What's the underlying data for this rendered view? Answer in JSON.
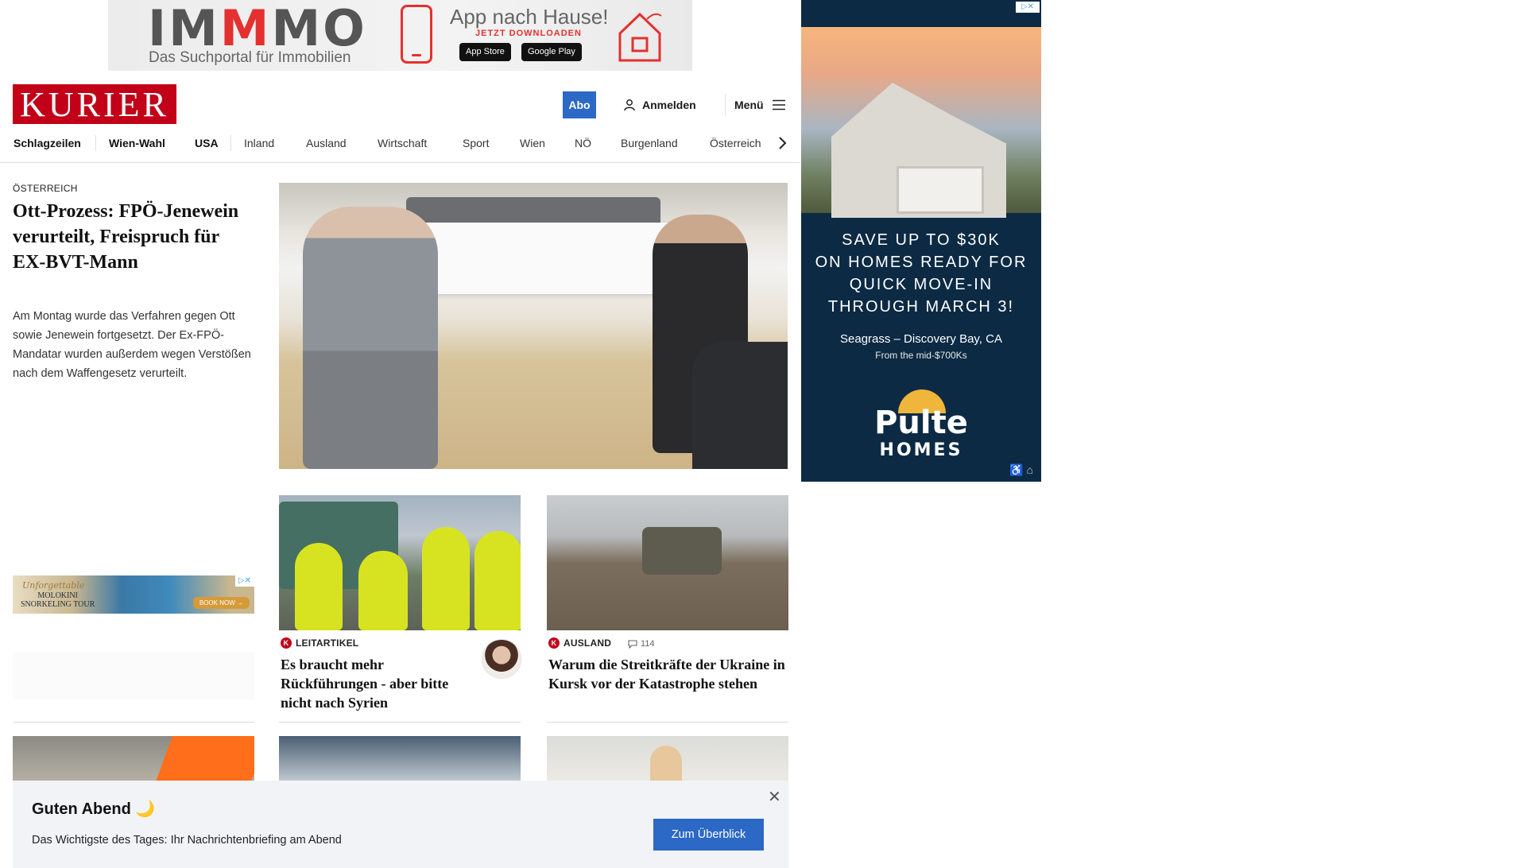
{
  "top_ad": {
    "brand_pre": "IM",
    "brand_mid": "M",
    "brand_post": "MO",
    "subline": "Das Suchportal für Immobilien",
    "headline": "App nach Hause!",
    "cta": "JETZT DOWNLOADEN",
    "appstore": "App Store",
    "googleplay": "Google Play"
  },
  "header": {
    "logo": "KURIER",
    "abo": "Abo",
    "login": "Anmelden",
    "menu": "Menü"
  },
  "nav": {
    "items": [
      "Schlagzeilen",
      "Wien-Wahl",
      "USA",
      "Inland",
      "Ausland",
      "Wirtschaft",
      "Sport",
      "Wien",
      "NÖ",
      "Burgenland",
      "Österreich"
    ]
  },
  "lead": {
    "kicker": "ÖSTERREICH",
    "title": "Ott-Prozess: FPÖ-Jenewein verurteilt, Freispruch für EX-BVT-Mann",
    "teaser": "Am Montag wurde das Verfahren gegen Ott sowie Jenewein fortgesetzt. Der Ex-FPÖ-Mandatar wurden außerdem wegen Verstößen nach dem Waffengesetz verurteilt."
  },
  "cards": [
    {
      "kicker": "LEITARTIKEL",
      "title": "Es braucht mehr Rückführungen - aber bitte nicht nach Syrien"
    },
    {
      "kicker": "AUSLAND",
      "comments": "114",
      "title": "Warum die Streitkräfte der Ukraine in Kursk vor der Katastrophe stehen"
    }
  ],
  "side_ad": {
    "copy": [
      "SAVE UP TO $30K",
      "ON HOMES READY FOR",
      "QUICK MOVE-IN",
      "THROUGH MARCH 3!"
    ],
    "location": "Seagrass – Discovery Bay, CA",
    "price": "From the mid-$700Ks",
    "brand": "Pulte",
    "brand_sub": "HOMES"
  },
  "small_ad": {
    "line1": "Unforgettable",
    "line2": "MOLOKINI",
    "line3": "SNORKELING TOUR",
    "button": "BOOK NOW →"
  },
  "briefing": {
    "title": "Guten Abend 🌙",
    "text": "Das Wichtigste des Tages: Ihr Nachrichtenbriefing am Abend",
    "button": "Zum Überblick",
    "close": "✕"
  },
  "colors": {
    "brand_red": "#c20018",
    "accent_blue": "#2c68c5"
  }
}
